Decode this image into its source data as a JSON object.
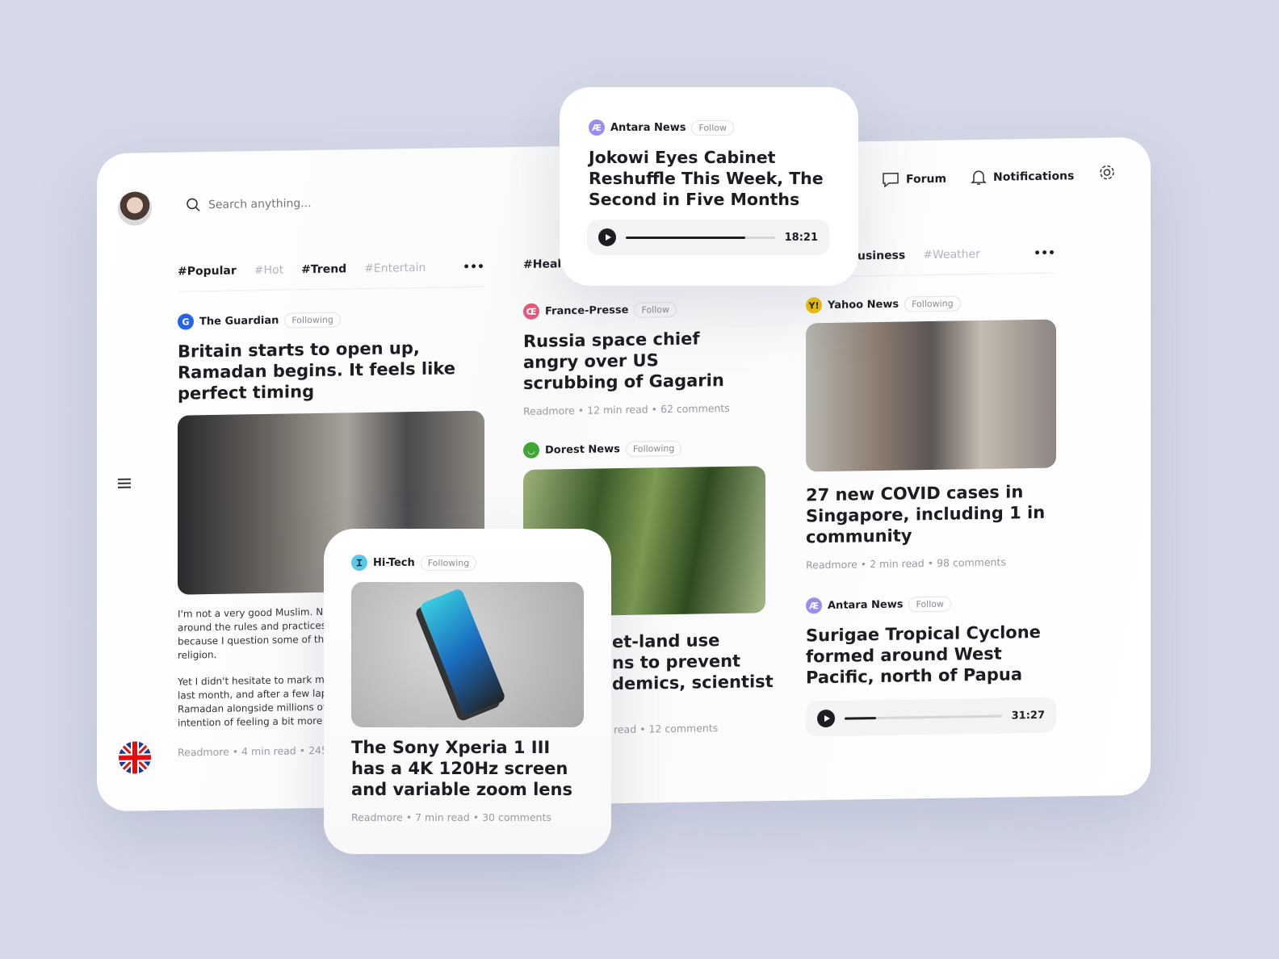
{
  "header": {
    "search_placeholder": "Search anything...",
    "forum": "Forum",
    "notifications": "Notifications"
  },
  "tabs": {
    "left": [
      "#Popular",
      "#Hot",
      "#Trend",
      "#Entertain"
    ],
    "middle": "#Heal",
    "right": [
      "usiness",
      "#Weather"
    ]
  },
  "col1": {
    "source": "The Guardian",
    "follow": "Following",
    "title": "Britain starts to open up, Ramadan begins. It feels like perfect timing",
    "body1": [
      "I'm not a very good Muslim. Not j",
      "around the rules and practices, b",
      "because I question some of the f",
      "religion."
    ],
    "body2": [
      "Yet I didn't hesitate to mark myse",
      "last month, and after a few lapse",
      "Ramadan alongside millions of o",
      "intention of feeling a bit more spi"
    ],
    "meta": [
      "Readmore",
      "4 min read",
      "245 c"
    ]
  },
  "col2": {
    "a1": {
      "source": "France-Presse",
      "follow": "Follow",
      "title": "Russia space chief angry over US scrubbing of Gagarin",
      "meta": [
        "Readmore",
        "12 min read",
        "62 comments"
      ]
    },
    "a2": {
      "source": "Dorest News",
      "follow": "Following",
      "title_lines": [
        "et-land use",
        "ns to prevent",
        "demics, scientist"
      ],
      "meta": [
        "read",
        "12 comments"
      ]
    }
  },
  "col3": {
    "a1": {
      "source": "Yahoo News",
      "follow": "Following",
      "title": "27 new COVID cases in Singapore, including 1 in community",
      "meta": [
        "Readmore",
        "2 min read",
        "98 comments"
      ]
    },
    "a2": {
      "source": "Antara News",
      "follow": "Follow",
      "title": "Surigae Tropical Cyclone formed around West Pacific, north of Papua",
      "duration": "31:27",
      "progress": 0.2
    }
  },
  "popup_top": {
    "source": "Antara News",
    "follow": "Follow",
    "title": "Jokowi Eyes Cabinet Reshuffle This Week, The Second in Five Months",
    "duration": "18:21",
    "progress": 0.8
  },
  "popup_bottom": {
    "source": "Hi-Tech",
    "follow": "Following",
    "title": "The Sony Xperia 1 III has a 4K 120Hz screen and variable zoom lens",
    "meta": [
      "Readmore",
      "7 min read",
      "30 comments"
    ]
  },
  "colors": {
    "background": "#d5d9e8",
    "text": "#1c1c22"
  }
}
